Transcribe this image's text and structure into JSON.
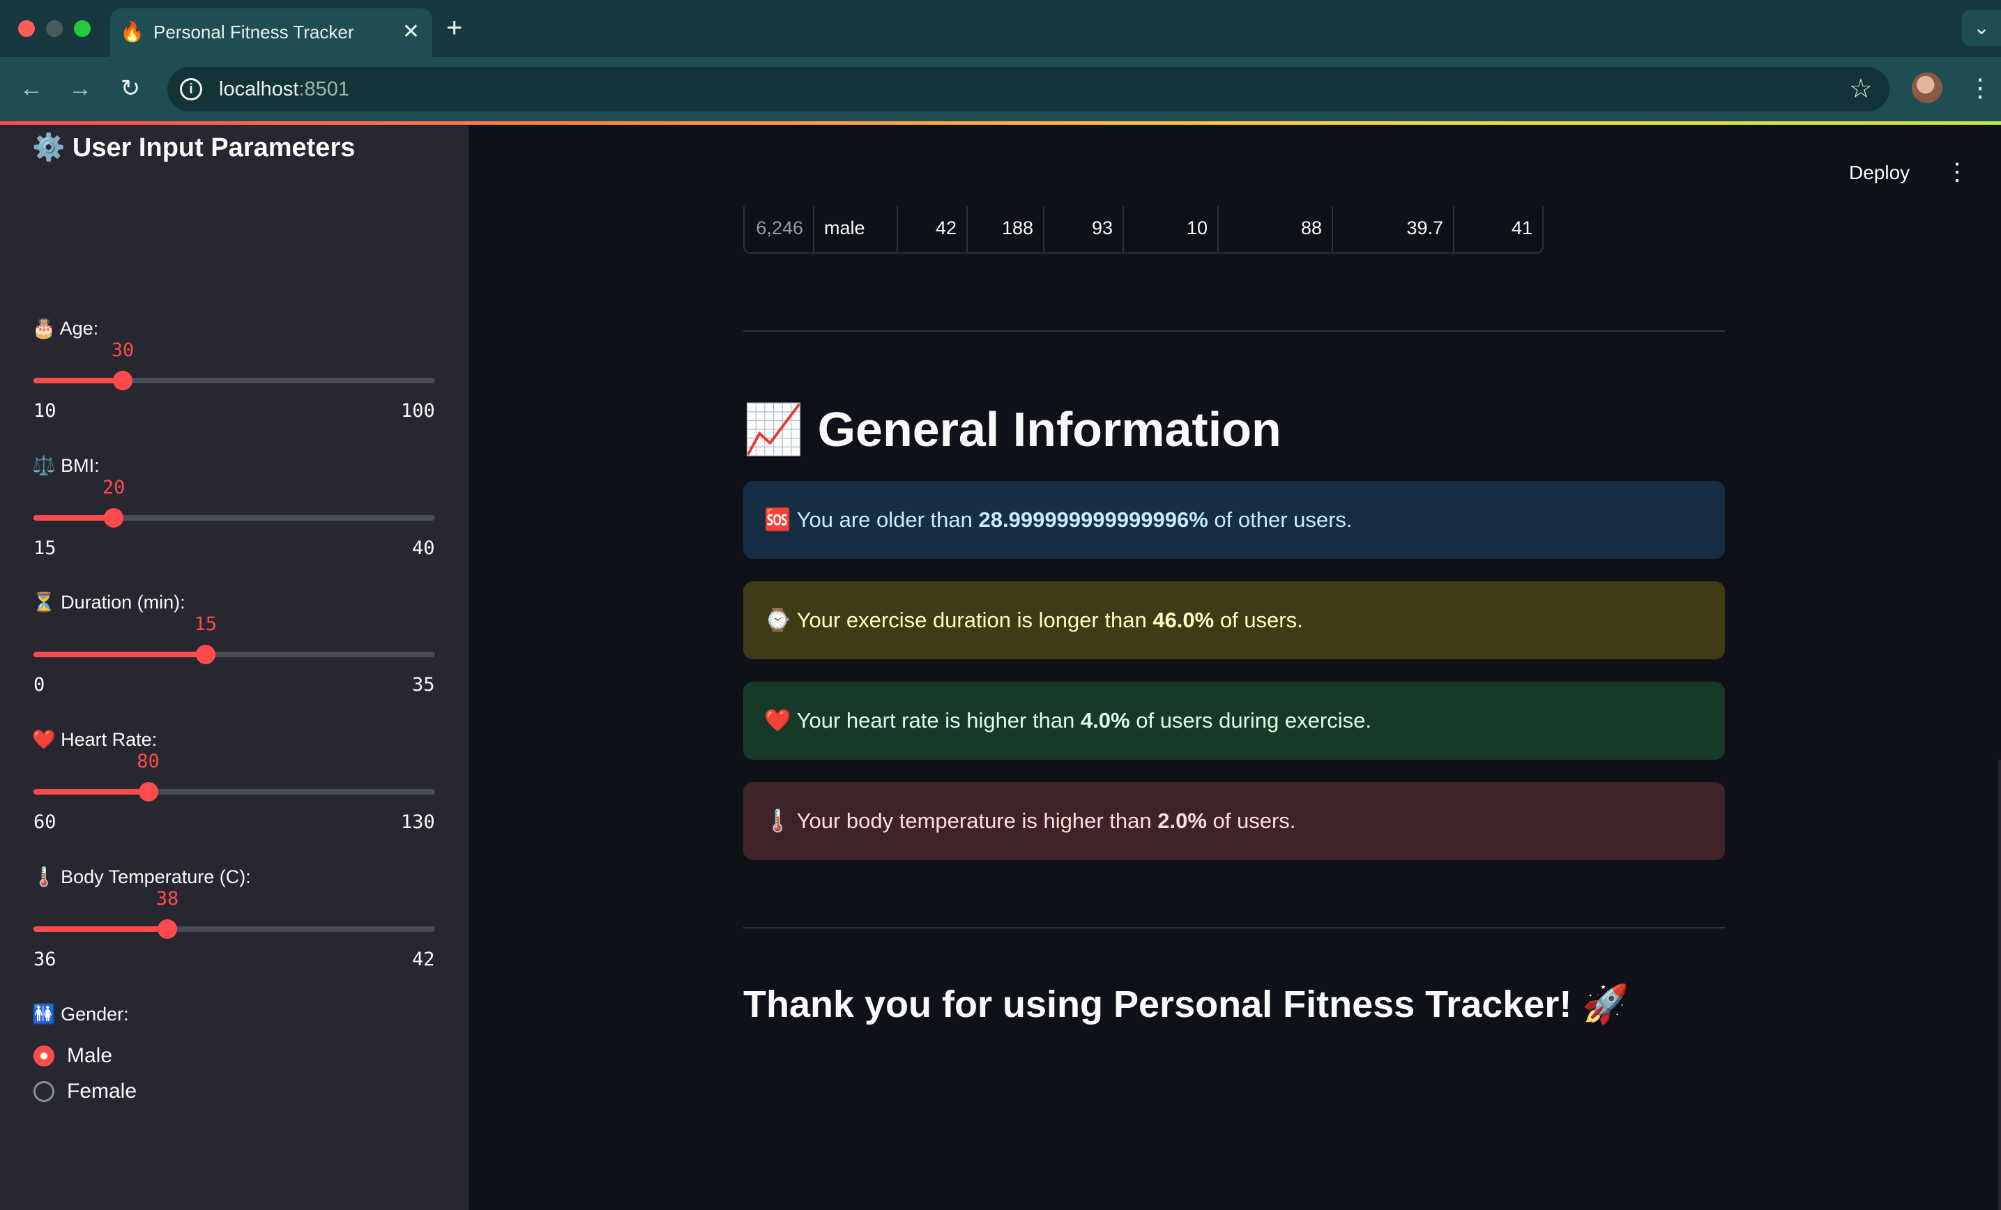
{
  "browser": {
    "tab_favicon": "🔥",
    "tab_title": "Personal Fitness Tracker",
    "tab_close": "✕",
    "new_tab": "+",
    "tab_menu": "⌄",
    "url_host": "localhost",
    "url_port": ":8501",
    "nav_back": "←",
    "nav_forward": "→",
    "nav_reload": "↻",
    "star": "☆",
    "menu": "⋮"
  },
  "header": {
    "deploy_label": "Deploy",
    "menu_glyph": "⋮"
  },
  "sidebar": {
    "title": "⚙️ User Input Parameters",
    "sliders": [
      {
        "label": "🎂 Age:",
        "value": 30,
        "min": 10,
        "max": 100
      },
      {
        "label": "⚖️ BMI:",
        "value": 20,
        "min": 15,
        "max": 40
      },
      {
        "label": "⏳ Duration (min):",
        "value": 15,
        "min": 0,
        "max": 35
      },
      {
        "label": "❤️ Heart Rate:",
        "value": 80,
        "min": 60,
        "max": 130
      },
      {
        "label": "🌡️ Body Temperature (C):",
        "value": 38,
        "min": 36,
        "max": 42
      }
    ],
    "gender": {
      "label": "🚻 Gender:",
      "options": [
        "Male",
        "Female"
      ],
      "selected": "Male"
    }
  },
  "table_row": {
    "cells": [
      "6,246",
      "male",
      "42",
      "188",
      "93",
      "10",
      "88",
      "39.7",
      "41"
    ]
  },
  "general_info": {
    "title": "📈 General Information",
    "alerts": [
      {
        "kind": "info",
        "prefix": "🆘 You are older than ",
        "value": "28.999999999999996%",
        "suffix": " of other users."
      },
      {
        "kind": "warning",
        "prefix": "⌚ Your exercise duration is longer than ",
        "value": "46.0%",
        "suffix": " of users."
      },
      {
        "kind": "success",
        "prefix": "❤️ Your heart rate is higher than ",
        "value": "4.0%",
        "suffix": " of users during exercise."
      },
      {
        "kind": "error",
        "prefix": "🌡️ Your body temperature is higher than ",
        "value": "2.0%",
        "suffix": " of users."
      }
    ]
  },
  "footer_message": "Thank you for using Personal Fitness Tracker! 🚀",
  "colors": {
    "accent": "#ff4b4b",
    "background": "#0e1117",
    "sidebar": "#262730",
    "info_bg": "#172d43",
    "warning_bg": "#3e3b16",
    "success_bg": "#173928",
    "error_bg": "#3e2428"
  }
}
